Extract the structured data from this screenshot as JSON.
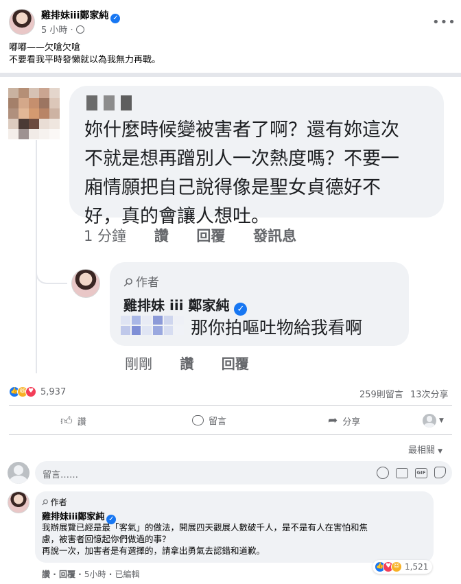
{
  "post": {
    "author": "雞排妹iii鄭家純",
    "time": "5 小時",
    "text_lines": [
      "嘟嘟——欠嗆欠嗆",
      "不要看我平時發懶就以為我無力再戰。"
    ]
  },
  "screenshot": {
    "comment_text_lines": [
      "妳什麼時候變被害者了啊？還有妳這次",
      "不就是想再蹭別人一次熱度嗎？不要一",
      "廂情願把自己說得像是聖女貞德好不",
      "好，真的會讓人想吐。"
    ],
    "comment_actions": [
      "1 分鐘",
      "讚",
      "回覆",
      "發訊息"
    ],
    "reply_badge": "作者",
    "reply_author": "雞排妹 iii 鄭家純",
    "reply_text": "那你拍嘔吐物給我看啊",
    "reply_actions": [
      "剛剛",
      "讚",
      "回覆"
    ]
  },
  "stats": {
    "reactions": "5,937",
    "comments": "259則留言",
    "shares": "13次分享"
  },
  "actions": {
    "like": "讚",
    "comment": "留言",
    "share": "分享"
  },
  "sort": {
    "label": "最相關"
  },
  "comment_box": {
    "placeholder": "留言……"
  },
  "author_comment": {
    "badge": "作者",
    "author": "雞排妹iii鄭家純",
    "lines": [
      "我辦展覽已經是最「客氣」的做法，開展四天觀展人數破千人，是不是有人在害怕和焦",
      "慮，被害者回憶起你們做過的事？",
      "再說一次，加害者是有選擇的，請拿出勇氣去認錯和道歉。"
    ],
    "like": "讚",
    "reply": "回覆",
    "time": "5小時",
    "edited": "已編輯",
    "reactions": "1,521"
  },
  "colors": {
    "accent": "#1877f2",
    "love": "#f33e58",
    "haha": "#f7b125"
  }
}
